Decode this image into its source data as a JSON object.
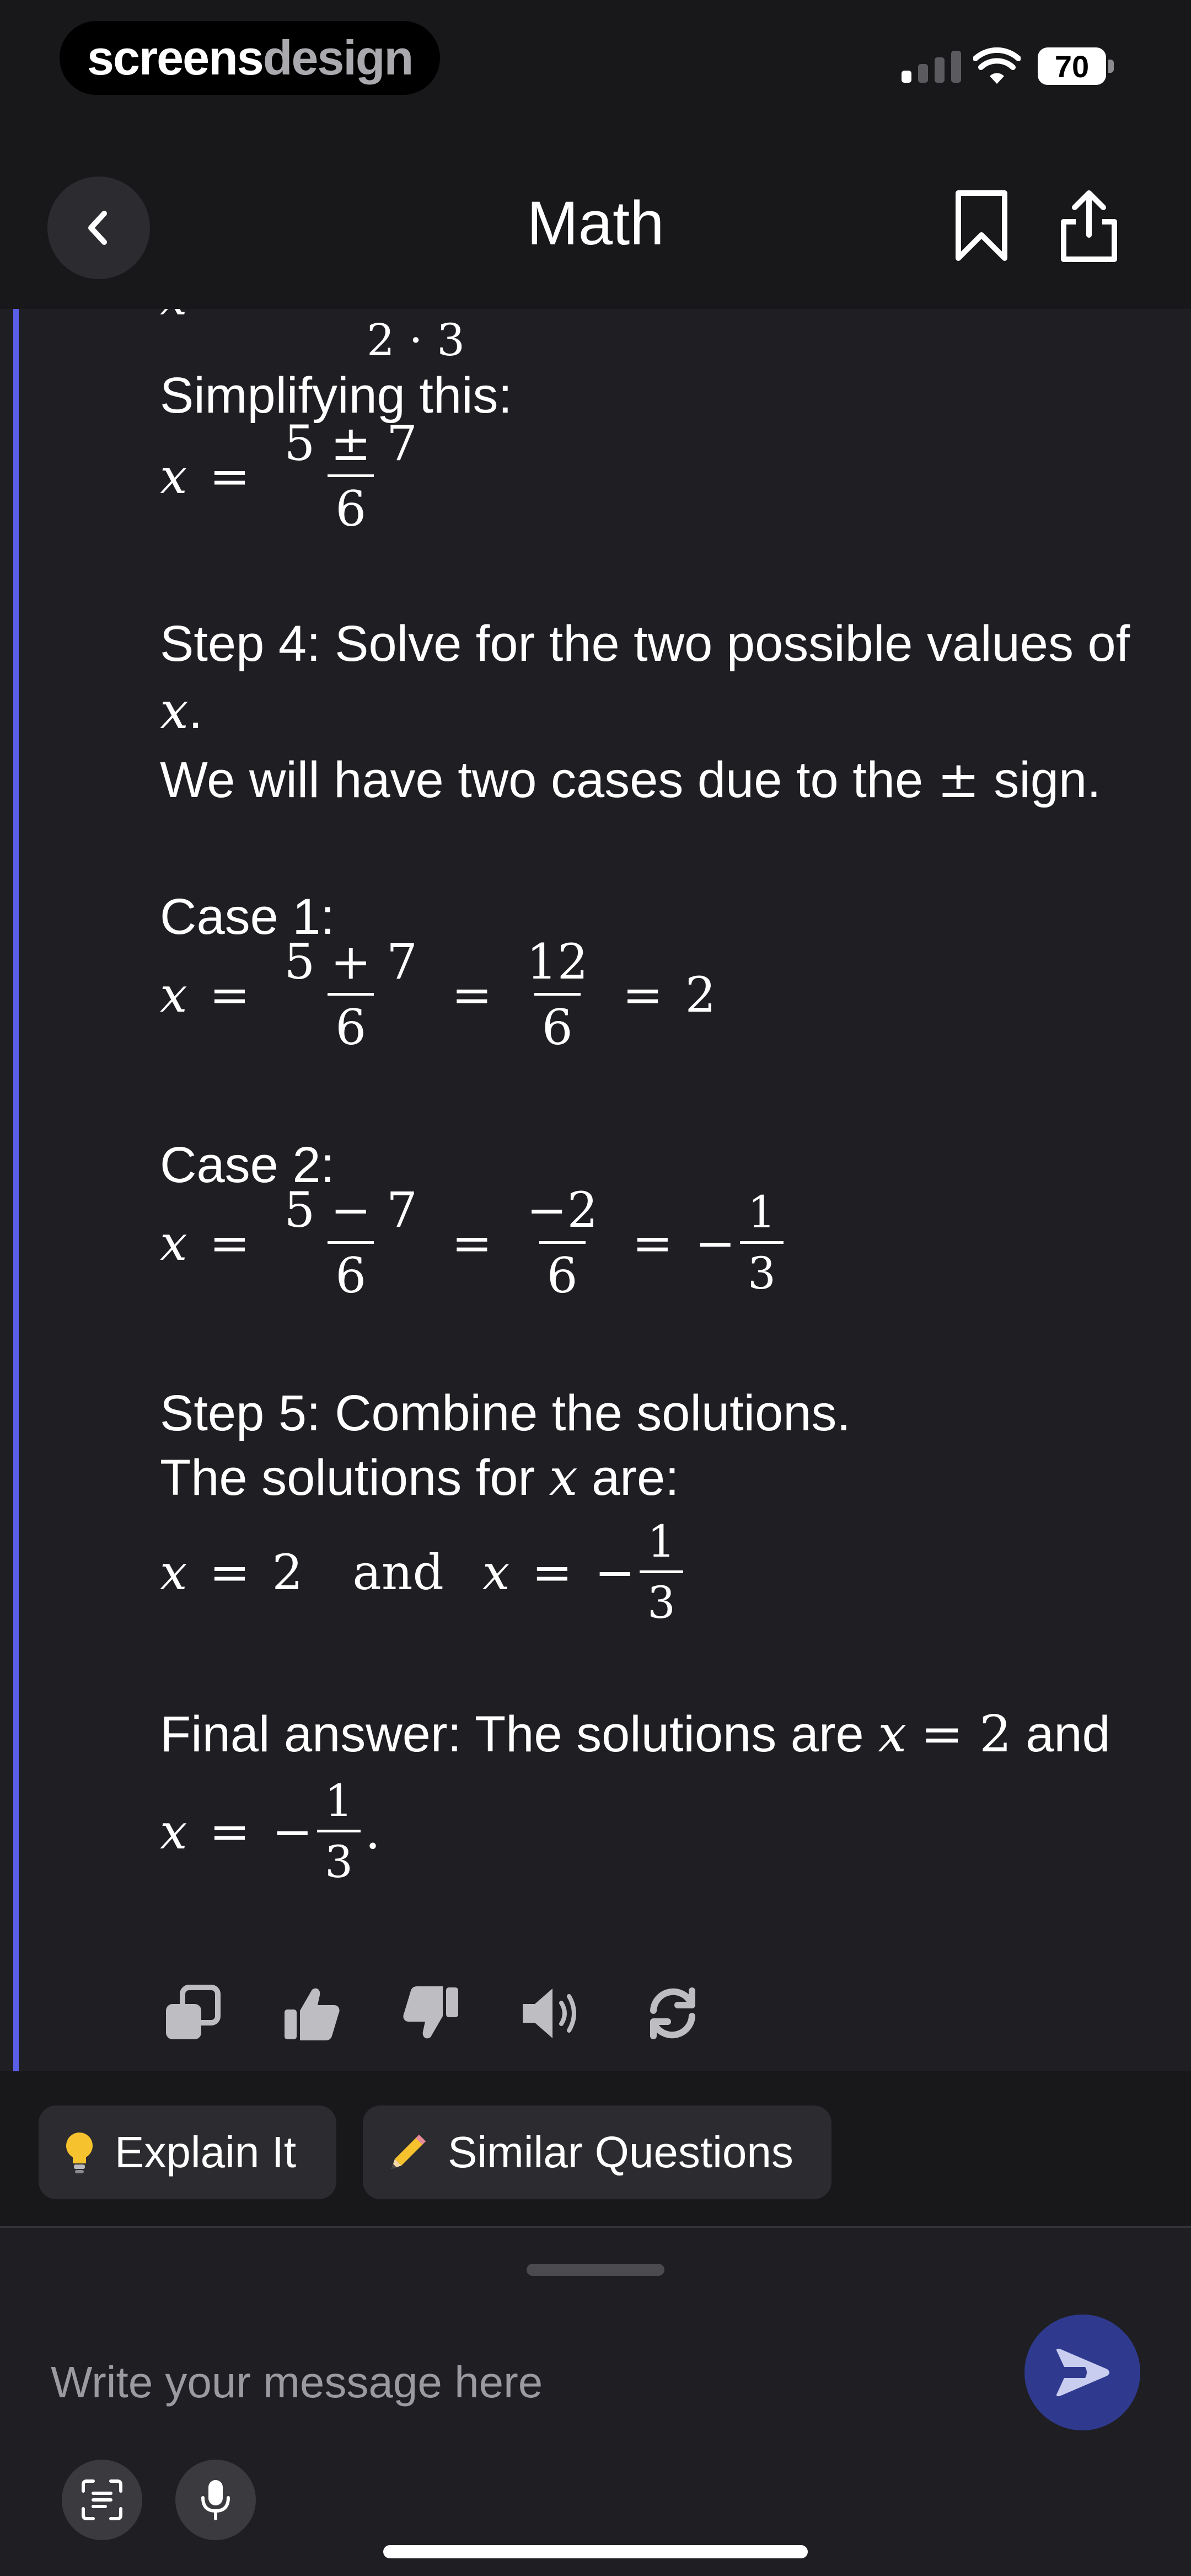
{
  "status_bar": {
    "brand_primary": "screens",
    "brand_secondary": "design",
    "battery": "70"
  },
  "header": {
    "title": "Math"
  },
  "message": {
    "partial_denominator": "2 · 3",
    "simplifying_label": "Simplifying this:",
    "simplified": {
      "var": "x",
      "eq": "=",
      "num": "5 ± 7",
      "den": "6"
    },
    "step4_line1": "Step 4: Solve for the two possible values of",
    "step4_var": "x",
    "step4_end": ".",
    "two_cases_before": "We will have two cases due to the",
    "two_cases_symbol": "±",
    "two_cases_after": "sign.",
    "case1_label": "Case 1:",
    "case1": {
      "var": "x",
      "eq": "=",
      "f1_num": "5 + 7",
      "f1_den": "6",
      "f2_num": "12",
      "f2_den": "6",
      "result": "2"
    },
    "case2_label": "Case 2:",
    "case2": {
      "var": "x",
      "eq": "=",
      "f1_num": "5 − 7",
      "f1_den": "6",
      "f2_num": "−2",
      "f2_den": "6",
      "sign": "−",
      "f3_num": "1",
      "f3_den": "3"
    },
    "step5_label": "Step 5: Combine the solutions.",
    "solutions_before": "The solutions for",
    "solutions_var": "x",
    "solutions_after": "are:",
    "combined": {
      "var1": "x",
      "eq": "=",
      "val1": "2",
      "and": "and",
      "var2": "x",
      "sign": "−",
      "num": "1",
      "den": "3"
    },
    "final_before": "Final answer: The solutions are",
    "final_var": "x",
    "final_eq": "= 2",
    "final_and": "and",
    "final2": {
      "var": "x",
      "eq": "=",
      "sign": "−",
      "num": "1",
      "den": "3",
      "end": "."
    }
  },
  "actions": [
    "copy-icon",
    "thumbs-up-icon",
    "thumbs-down-icon",
    "speaker-icon",
    "regenerate-icon"
  ],
  "suggestions": [
    {
      "icon": "lightbulb-icon",
      "label": "Explain It"
    },
    {
      "icon": "pencil-icon",
      "label": "Similar Questions"
    }
  ],
  "composer": {
    "placeholder": "Write your message here"
  },
  "colors": {
    "background": "#1f1f23",
    "accent_bar": "#5b5fe8",
    "send_button": "#2f3a8f"
  }
}
